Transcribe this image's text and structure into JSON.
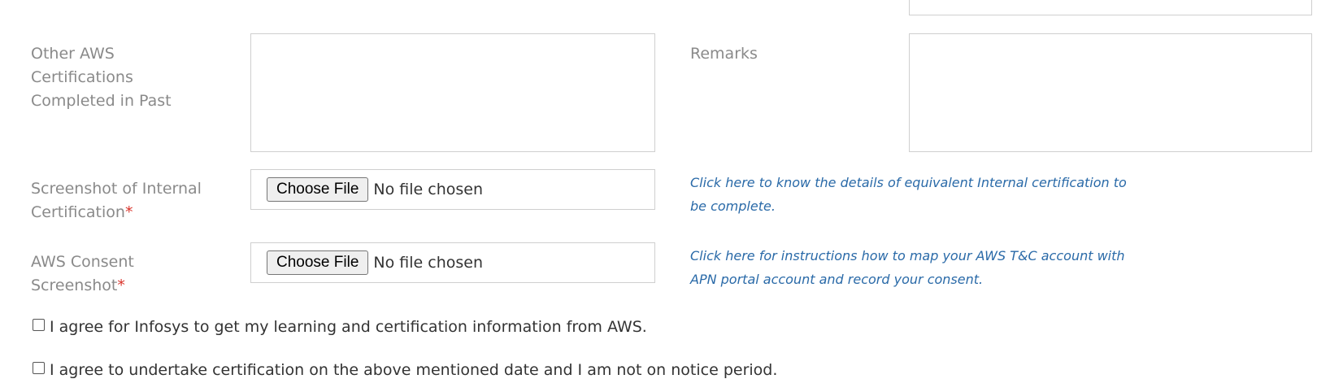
{
  "form": {
    "other_certs": {
      "label": "Other AWS Certifications Completed in Past",
      "value": ""
    },
    "remarks": {
      "label": "Remarks",
      "value": ""
    },
    "internal_cert_screenshot": {
      "label": "Screenshot of Internal Certification",
      "required_marker": "*",
      "button_label": "Choose File",
      "status": "No file chosen"
    },
    "aws_consent_screenshot": {
      "label": "AWS Consent Screenshot",
      "required_marker": "*",
      "button_label": "Choose File",
      "status": "No file chosen"
    },
    "links": {
      "internal_cert_details": "Click here to know the details of equivalent Internal certification to be complete.",
      "consent_instructions": "Click here for instructions how to map your AWS T&C account with APN portal account and record your consent."
    },
    "agreements": [
      {
        "label": "I agree for Infosys to get my learning and certification information from AWS.",
        "checked": false
      },
      {
        "label": "I agree to undertake certification on the above mentioned date and I am not on notice period.",
        "checked": false
      }
    ]
  },
  "colors": {
    "label_text": "#8a8a8a",
    "link_text": "#2a6aa8",
    "required": "#d9342b",
    "border": "#cfcfcf"
  }
}
